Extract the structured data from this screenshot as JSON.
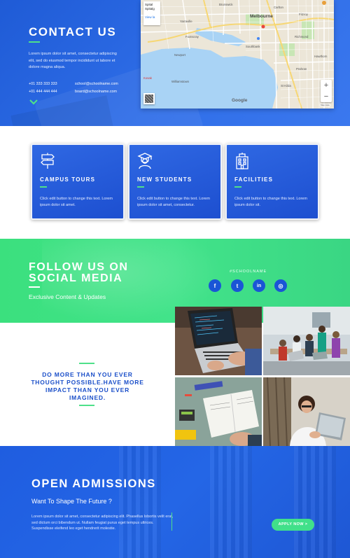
{
  "contact": {
    "title": "CONTACT US",
    "description": "Lorem ipsum dolor sit amet, consectetur adipiscing elit, sed do eiusmod tempor incididunt ut labore et dolore magna aliqua.",
    "phone_1": "+01 333 333 333",
    "phone_2": "+01 444 444 444",
    "email_1": "school@schoolname.com",
    "email_2": "board@schoolname.com",
    "scroll_icon": "chevron-down-icon"
  },
  "map": {
    "city": "Melbourne",
    "place_card_line1": "Spital",
    "place_card_line2": "Spitalg",
    "place_card_link": "View la",
    "labels": [
      "Yarraville",
      "Newport",
      "Williamstown",
      "Kosak",
      "Southbank",
      "St Kilda",
      "Richmond",
      "Carlton",
      "Fitzroy",
      "Hawthorn",
      "Prahran",
      "Footscray",
      "Brunswick"
    ],
    "google_logo": "Google",
    "zoom_in": "+",
    "zoom_out": "−",
    "credits": "Map data"
  },
  "cards": [
    {
      "title": "CAMPUS TOURS",
      "text": "Click edit button to change this text. Lorem ipsum dolor sit amet.",
      "icon": "signpost-icon"
    },
    {
      "title": "NEW STUDENTS",
      "text": "Click edit button to change this text. Lorem ipsum dolor sit amet, consectetur.",
      "icon": "graduate-icon"
    },
    {
      "title": "FACILITIES",
      "text": "Click edit button to change this text. Lorem ipsum dolor sit.",
      "icon": "building-icon"
    }
  ],
  "follow": {
    "title": "FOLLOW US ON SOCIAL MEDIA",
    "subtitle": "Exclusive Content & Updates",
    "hashtag": "#SCHOOLNAME",
    "social": [
      {
        "name": "facebook-icon",
        "glyph": "f"
      },
      {
        "name": "twitter-icon",
        "glyph": "t"
      },
      {
        "name": "linkedin-icon",
        "glyph": "in"
      },
      {
        "name": "instagram-icon",
        "glyph": "◎"
      }
    ]
  },
  "quote": "DO MORE THAN YOU EVER THOUGHT POSSIBLE.HAVE MORE IMPACT THAN YOU EVER IMAGINED.",
  "admissions": {
    "title": "OPEN ADMISSIONS",
    "subtitle": "Want To Shape The Future ?",
    "text": "Lorem ipsum dolor sit amet, consectetur adipiscing elit. Phasellus lobortis velit erat, sed dictum orci bibendum ut. Nullam feugiat purus eget tempus ultrices. Suspendisse eleifend leo eget hendrerit molestie.",
    "button": "APPLY NOW >"
  },
  "colors": {
    "brand_blue": "#2563e6",
    "accent_green": "#42e38a"
  }
}
